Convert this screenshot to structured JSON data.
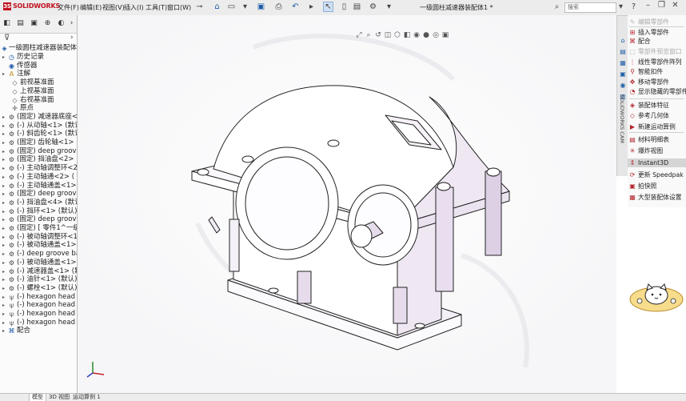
{
  "app": {
    "logo": "SOLIDWORKS",
    "doc_title": "一级圆柱减速器装配体1 *",
    "search_placeholder": "搜索"
  },
  "menu": [
    "文件(F)",
    "编辑(E)",
    "视图(V)",
    "插入(I)",
    "工具(T)",
    "窗口(W)"
  ],
  "tree": {
    "root": "一级圆柱减速器装配体",
    "items": [
      {
        "label": "历史记录",
        "icon": "history-icon",
        "expand": "▸"
      },
      {
        "label": "传感器",
        "icon": "sensor-icon",
        "expand": ""
      },
      {
        "label": "注解",
        "icon": "annotation-icon",
        "expand": "▸"
      },
      {
        "label": "前视基准面",
        "icon": "plane-icon",
        "expand": ""
      },
      {
        "label": "上视基准面",
        "icon": "plane-icon",
        "expand": ""
      },
      {
        "label": "右视基准面",
        "icon": "plane-icon",
        "expand": ""
      },
      {
        "label": "原点",
        "icon": "origin-icon",
        "expand": ""
      },
      {
        "label": "(固定) 减速器底座<1> (",
        "icon": "part-icon",
        "expand": "▸"
      },
      {
        "label": "(-) 从动轴<1> (默认",
        "icon": "part-icon",
        "expand": "▸"
      },
      {
        "label": "(-) 斜齿轮<1> (默认",
        "icon": "part-icon",
        "expand": "▸"
      },
      {
        "label": "(固定) 齿轮轴<1> (默",
        "icon": "part-icon",
        "expand": "▸"
      },
      {
        "label": "(固定) deep groov",
        "icon": "part-icon",
        "expand": "▸"
      },
      {
        "label": "(固定) 挡油盘<2> (",
        "icon": "part-icon",
        "expand": "▸"
      },
      {
        "label": "(-) 主动轴调整环<2>",
        "icon": "part-icon",
        "expand": "▸"
      },
      {
        "label": "(-) 主动轴通<2> (",
        "icon": "part-icon",
        "expand": "▸"
      },
      {
        "label": "(-) 主动轴通盖<1> (",
        "icon": "part-icon",
        "expand": "▸"
      },
      {
        "label": "(固定) deep groov",
        "icon": "part-icon",
        "expand": "▸"
      },
      {
        "label": "(-) 挡油盘<4> (默认",
        "icon": "part-icon",
        "expand": "▸"
      },
      {
        "label": "(-) 挡环<1> (默认) <",
        "icon": "part-icon",
        "expand": "▸"
      },
      {
        "label": "(固定) deep groov",
        "icon": "part-icon",
        "expand": "▸"
      },
      {
        "label": "(固定) [ 零件1^一级",
        "icon": "part-icon",
        "expand": "▸"
      },
      {
        "label": "(-) 被动轴调整环<1>",
        "icon": "part-icon",
        "expand": "▸"
      },
      {
        "label": "(-) 被动轴通盖<1> (",
        "icon": "part-icon",
        "expand": "▸"
      },
      {
        "label": "(-) deep groove ba",
        "icon": "part-icon",
        "expand": "▸"
      },
      {
        "label": "(-) 被动轴通盖<1> (",
        "icon": "part-icon",
        "expand": "▸"
      },
      {
        "label": "(-) 减速器盖<1> (默",
        "icon": "part-icon",
        "expand": "▸"
      },
      {
        "label": "(-) 油针<1> (默认) <",
        "icon": "part-icon",
        "expand": "▸"
      },
      {
        "label": "(-) 螺栓<1> (默认) <",
        "icon": "part-icon",
        "expand": "▸"
      },
      {
        "label": "(-) hexagon head",
        "icon": "bolt-icon",
        "expand": "▸"
      },
      {
        "label": "(-) hexagon head",
        "icon": "bolt-icon",
        "expand": "▸"
      },
      {
        "label": "(-) hexagon head",
        "icon": "bolt-icon",
        "expand": "▸"
      },
      {
        "label": "(-) hexagon head",
        "icon": "bolt-icon",
        "expand": "▸"
      },
      {
        "label": "配合",
        "icon": "mates-icon",
        "expand": "▸"
      }
    ]
  },
  "commands": [
    {
      "label": "编辑零部件",
      "icon": "edit-component-icon",
      "dim": true
    },
    {
      "label": "插入零部件",
      "icon": "insert-component-icon",
      "dim": false
    },
    {
      "label": "配合",
      "icon": "mate-icon",
      "dim": false
    },
    {
      "label": "零部件预览窗口",
      "icon": "preview-window-icon",
      "dim": true
    },
    {
      "label": "线性零部件阵列",
      "icon": "linear-pattern-icon",
      "dim": false
    },
    {
      "label": "智能扣件",
      "icon": "smart-fastener-icon",
      "dim": false
    },
    {
      "label": "移动零部件",
      "icon": "move-component-icon",
      "dim": false
    },
    {
      "label": "显示隐藏的零部件",
      "icon": "show-hidden-icon",
      "dim": false
    },
    {
      "label": "装配体特征",
      "icon": "assembly-feature-icon",
      "dim": false
    },
    {
      "label": "参考几何体",
      "icon": "reference-geometry-icon",
      "dim": false
    },
    {
      "label": "新建运动算例",
      "icon": "motion-study-icon",
      "dim": false
    },
    {
      "label": "材料明细表",
      "icon": "bom-icon",
      "dim": false
    },
    {
      "label": "爆炸视图",
      "icon": "exploded-view-icon",
      "dim": false
    },
    {
      "label": "Instant3D",
      "icon": "instant3d-icon",
      "dim": false
    },
    {
      "label": "更新 Speedpak",
      "icon": "speedpak-icon",
      "dim": false
    },
    {
      "label": "拍快照",
      "icon": "snapshot-icon",
      "dim": false
    },
    {
      "label": "大型装配体设置",
      "icon": "large-assembly-icon",
      "dim": false
    }
  ],
  "strip_label": "SOLIDWORKS CAM",
  "bottom_tabs": [
    "模型",
    "3D 视图",
    "运动算例 1"
  ]
}
